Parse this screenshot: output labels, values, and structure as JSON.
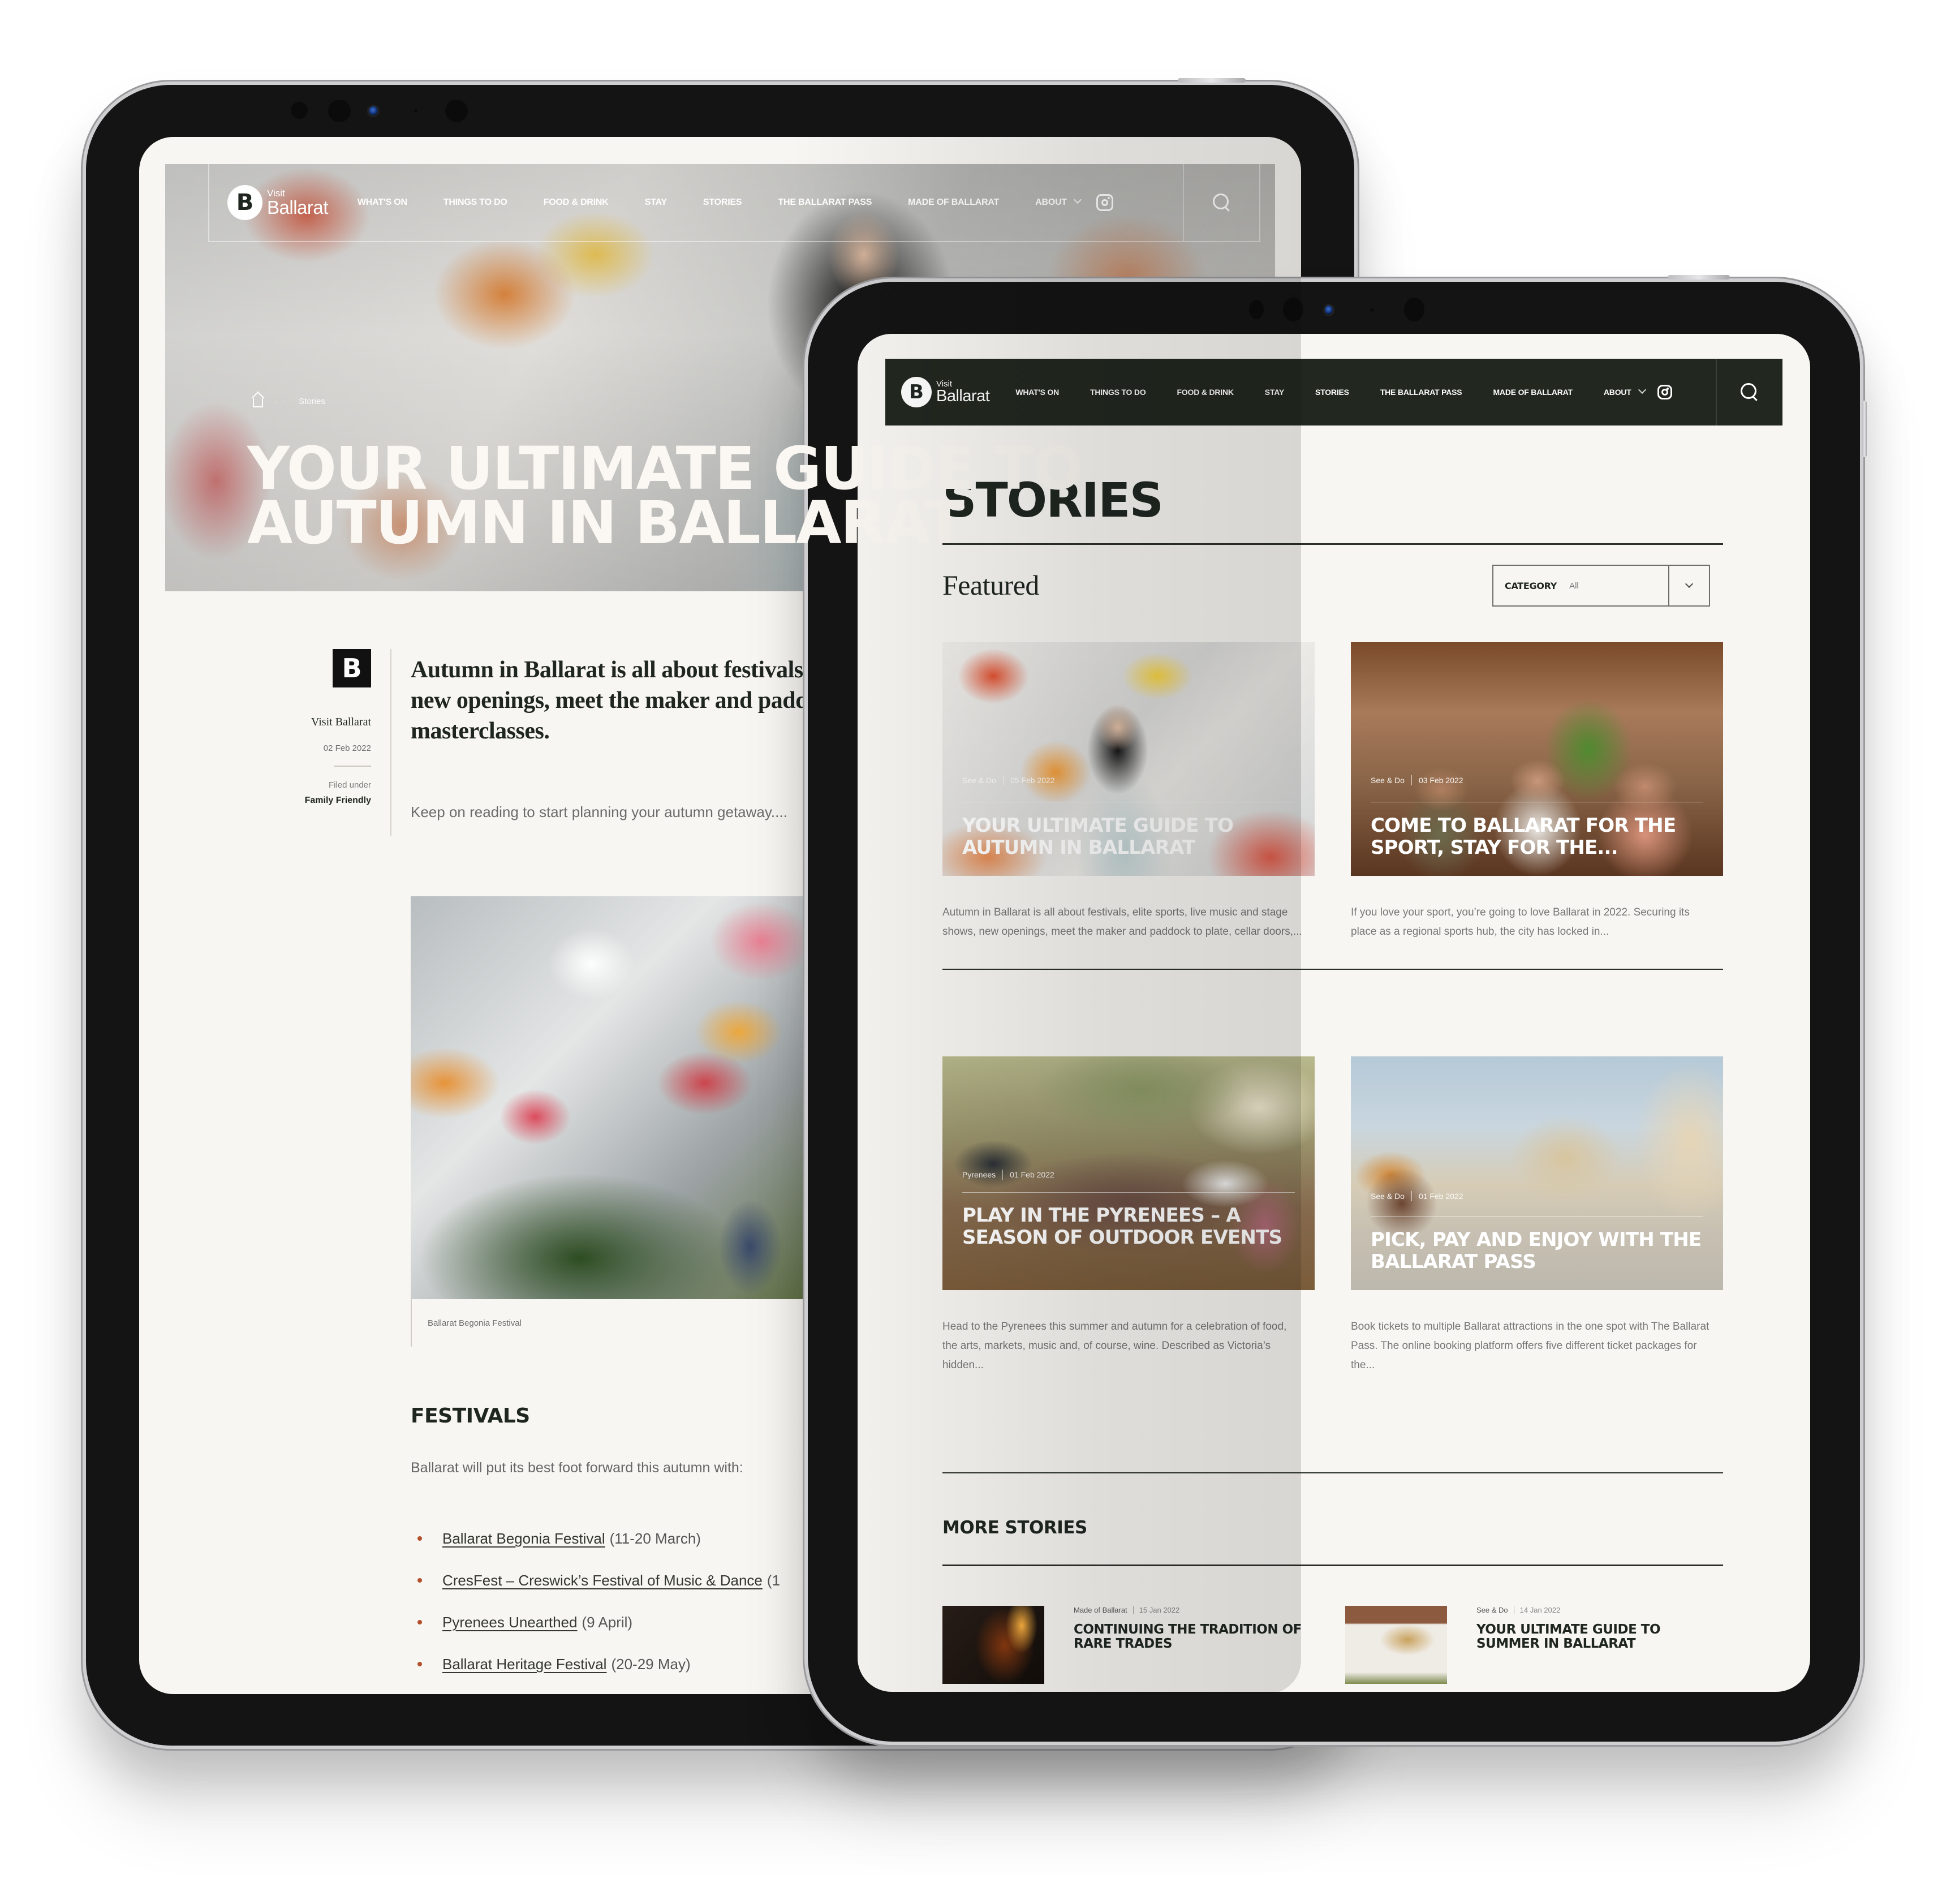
{
  "site": {
    "logo": {
      "top": "Visit",
      "bottom": "Ballarat",
      "mark": "B"
    },
    "nav": [
      "What's On",
      "Things To Do",
      "Food & Drink",
      "Stay",
      "Stories",
      "The Ballarat Pass",
      "Made of Ballarat",
      "About"
    ],
    "icons": {
      "instagram": "instagram-icon",
      "search": "search-icon",
      "about_dropdown": "chevron-down-icon"
    }
  },
  "article": {
    "breadcrumb": {
      "home": "home-icon",
      "current": "Stories"
    },
    "title_lines": [
      "YOUR ULTIMATE GUIDE TO",
      "AUTUMN IN BALLARAT"
    ],
    "author": "Visit Ballarat",
    "date": "02 Feb 2022",
    "filed_under_label": "Filed under",
    "category": "Family Friendly",
    "intro": "Autumn in Ballarat is all about festivals, elite sports, live music and stage shows, new openings, meet the maker and paddock to plate, cellar doors, plus masterclasses.",
    "intro_sub": "Keep on reading to start planning your autumn getaway....",
    "image_caption": "Ballarat Begonia Festival",
    "section_heading": "FESTIVALS",
    "section_text": "Ballarat will put its best foot forward this autumn with:",
    "festivals": [
      {
        "name": "Ballarat Begonia Festival",
        "dates": "(11-20 March)"
      },
      {
        "name": "CresFest – Creswick’s Festival of Music & Dance",
        "dates": "(1"
      },
      {
        "name": "Pyrenees Unearthed",
        "dates": "(9 April)"
      },
      {
        "name": "Ballarat Heritage Festival",
        "dates": "(20-29 May)"
      }
    ]
  },
  "stories": {
    "page_title": "STORIES",
    "featured_heading": "Featured",
    "category_filter": {
      "label": "CATEGORY",
      "value": "All"
    },
    "featured": [
      {
        "category": "See & Do",
        "date": "05 Feb 2022",
        "title": "Your Ultimate Guide to Autumn in Ballarat",
        "description": "Autumn in Ballarat is all about festivals, elite sports, live music and stage shows, new openings, meet the maker and paddock to plate, cellar doors,..."
      },
      {
        "category": "See & Do",
        "date": "03 Feb 2022",
        "title": "Come to Ballarat for the Sport, Stay for the...",
        "description": "If you love your sport, you’re going to love Ballarat in 2022. Securing its place as a regional sports hub, the city has locked in..."
      },
      {
        "category": "Pyrenees",
        "date": "01 Feb 2022",
        "title": "Play in the Pyrenees – A Season of Outdoor Events",
        "description": "Head to the Pyrenees this summer and autumn for a celebration of food, the arts, markets, music and, of course, wine. Described as Victoria’s hidden..."
      },
      {
        "category": "See & Do",
        "date": "01 Feb 2022",
        "title": "Pick, Pay and Enjoy with the Ballarat Pass",
        "description": "Book tickets to multiple Ballarat attractions in the one spot with The Ballarat Pass. The online booking platform offers five different ticket packages for the..."
      }
    ],
    "more_heading": "MORE STORIES",
    "more": [
      {
        "category": "Made of Ballarat",
        "date": "15 Jan 2022",
        "title": "Continuing the Tradition of Rare Trades"
      },
      {
        "category": "See & Do",
        "date": "14 Jan 2022",
        "title": "Your Ultimate Guide to Summer in Ballarat"
      }
    ]
  },
  "colors": {
    "nav_dark": "#222820",
    "page_bg": "#f8f6f2",
    "text_dark": "#1f2620",
    "bullet": "#b3502b"
  }
}
